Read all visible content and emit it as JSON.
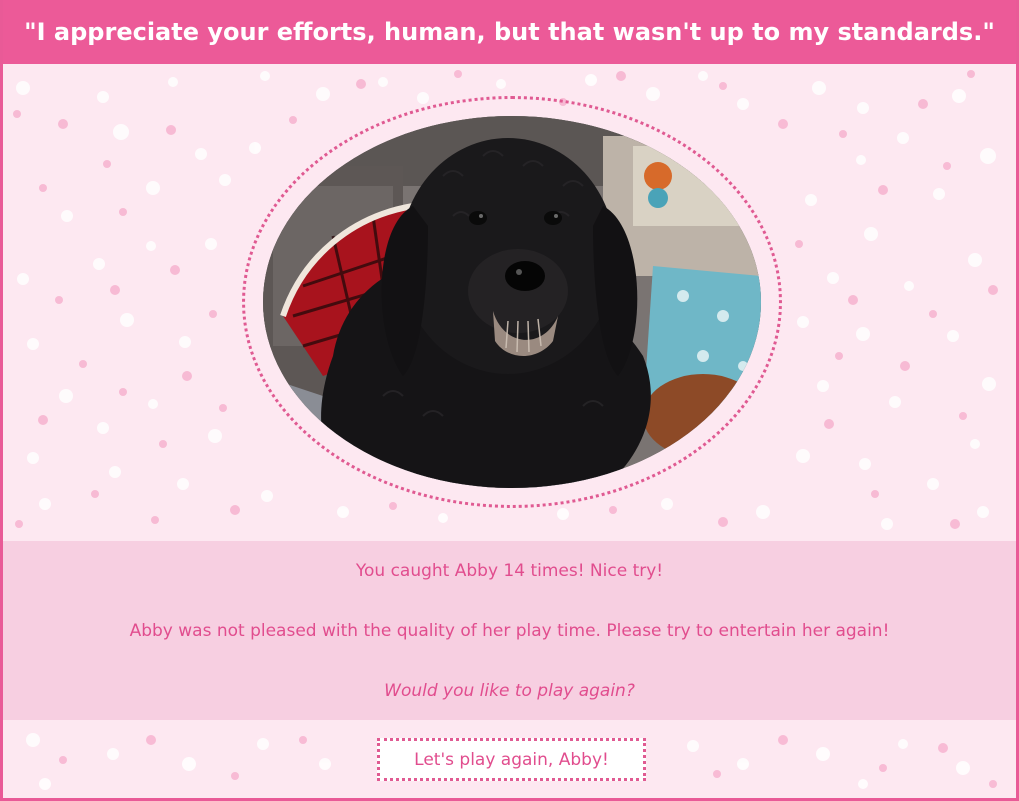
{
  "header": {
    "quote": "\"I appreciate your efforts, human, but that wasn't up to my standards.\""
  },
  "photo": {
    "subject": "Abby the dog"
  },
  "result": {
    "score_text": "You caught Abby 14 times! Nice try!",
    "verdict_text": "Abby was not pleased with the quality of her play time. Please try to entertain her again!",
    "prompt_text": "Would you like to play again?"
  },
  "actions": {
    "play_again_label": "Let's play again, Abby!"
  },
  "colors": {
    "accent": "#ec5a98",
    "background": "#fde8f1",
    "band": "#f5c8dd",
    "text": "#e14d8e"
  }
}
